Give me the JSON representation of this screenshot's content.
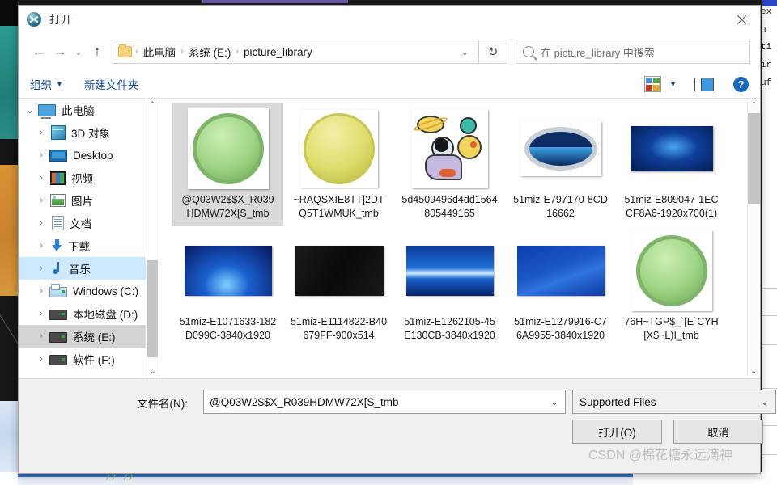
{
  "window": {
    "title": "打开",
    "app_icon": "tool-globe-icon",
    "close_icon": "close-icon"
  },
  "nav": {
    "back_icon": "arrow-left-icon",
    "forward_icon": "arrow-right-icon",
    "recent_icon": "chevron-down-icon",
    "up_icon": "arrow-up-icon",
    "folder_icon": "folder-icon",
    "breadcrumbs": [
      "此电脑",
      "系统 (E:)",
      "picture_library"
    ],
    "separator": "›",
    "dropdown_caret": "⌄",
    "refresh_icon": "↻",
    "search_icon": "search-icon",
    "search_placeholder": "在 picture_library 中搜索"
  },
  "commandbar": {
    "organize_label": "组织",
    "organize_caret": "▼",
    "new_folder_label": "新建文件夹",
    "view_icon": "view-tiles-icon",
    "view_caret": "▼",
    "preview_pane_icon": "preview-pane-icon",
    "help_icon": "?"
  },
  "sidebar": {
    "scroll_up_icon": "⌃",
    "scroll_down_icon": "⌄",
    "items": [
      {
        "label": "此电脑",
        "icon": "computer-icon",
        "chevron": "⌄",
        "expanded": true,
        "state": "none"
      },
      {
        "label": "3D 对象",
        "icon": "3d-objects-icon",
        "chevron": "›",
        "expanded": false,
        "state": "none"
      },
      {
        "label": "Desktop",
        "icon": "desktop-icon",
        "chevron": "›",
        "expanded": false,
        "state": "none"
      },
      {
        "label": "视频",
        "icon": "videos-icon",
        "chevron": "›",
        "expanded": false,
        "state": "none"
      },
      {
        "label": "图片",
        "icon": "pictures-icon",
        "chevron": "›",
        "expanded": false,
        "state": "none"
      },
      {
        "label": "文档",
        "icon": "documents-icon",
        "chevron": "›",
        "expanded": false,
        "state": "none"
      },
      {
        "label": "下载",
        "icon": "downloads-icon",
        "chevron": "›",
        "expanded": false,
        "state": "none"
      },
      {
        "label": "音乐",
        "icon": "music-icon",
        "chevron": "›",
        "expanded": false,
        "state": "hover"
      },
      {
        "label": "Windows (C:)",
        "icon": "drive-windows-icon",
        "chevron": "›",
        "expanded": false,
        "state": "none"
      },
      {
        "label": "本地磁盘 (D:)",
        "icon": "drive-icon",
        "chevron": "›",
        "expanded": false,
        "state": "none"
      },
      {
        "label": "系统 (E:)",
        "icon": "drive-icon",
        "chevron": "›",
        "expanded": false,
        "state": "selected"
      },
      {
        "label": "软件 (F:)",
        "icon": "drive-icon",
        "chevron": "›",
        "expanded": false,
        "state": "none"
      }
    ]
  },
  "files": {
    "scroll_up_icon": "⌃",
    "scroll_down_icon": "⌄",
    "items": [
      {
        "name": "@Q03W2$$X_R039HDMW72X[S_tmb",
        "thumb": "green-glass-button",
        "selected": true
      },
      {
        "name": "~RAQSXIE8TT]2DTQ5T1WMUK_tmb",
        "thumb": "yellow-glass-button",
        "selected": false
      },
      {
        "name": "5d4509496d4dd1564805449165",
        "thumb": "astronaut-space",
        "selected": false
      },
      {
        "name": "51miz-E797170-8CD16662",
        "thumb": "blue-oval-badge",
        "selected": false
      },
      {
        "name": "51miz-E809047-1ECCF8A6-1920x700(1)",
        "thumb": "blue-nebula",
        "selected": false
      },
      {
        "name": "51miz-E1071633-182D099C-3840x1920",
        "thumb": "blue-starburst",
        "selected": false
      },
      {
        "name": "51miz-E1114822-B40679FF-900x514",
        "thumb": "black-texture",
        "selected": false
      },
      {
        "name": "51miz-E1262105-45E130CB-3840x1920",
        "thumb": "blue-horizon",
        "selected": false
      },
      {
        "name": "51miz-E1279916-C76A9955-3840x1920",
        "thumb": "blue-wave",
        "selected": false
      },
      {
        "name": "76H~TGP$_`[E`CYH[X$~L)I_tmb",
        "thumb": "green-glass-button",
        "selected": false
      }
    ]
  },
  "bottom": {
    "filename_label": "文件名(N):",
    "filename_value": "@Q03W2$$X_R039HDMW72X[S_tmb",
    "filename_caret": "⌄",
    "filetype_value": "Supported Files",
    "filetype_caret": "⌄",
    "open_label": "打开(O)",
    "cancel_label": "取消"
  },
  "watermark": "CSDN @棉花糖永远滴神",
  "background": {
    "code_text": "ex\nn\nti\nir\nuf",
    "slash_text": "// //"
  },
  "colors": {
    "accent_blue": "#1468c0",
    "selection_light": "#cde8ff",
    "selection_grey": "#d4d4d4",
    "dialog_face": "#f0f0f0",
    "link_blue": "#1c4f96"
  }
}
